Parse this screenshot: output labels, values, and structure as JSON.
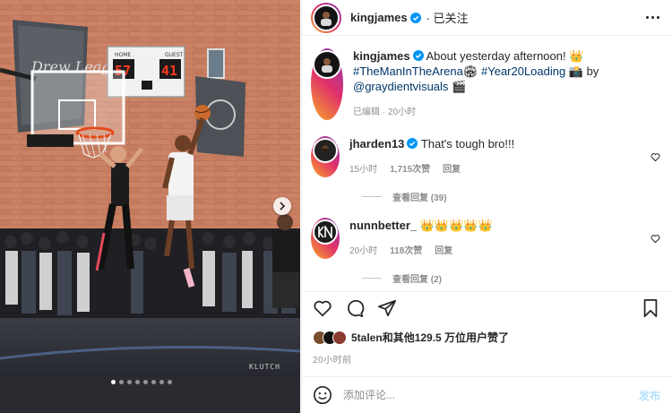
{
  "post": {
    "author": "kingjames",
    "follow_status": "· 已关注",
    "photo_watermark": "KLUTCH",
    "scoreboard": {
      "home_label": "HOME",
      "guest_label": "GUEST",
      "home_score": "57",
      "guest_score": "41"
    },
    "banner_text": "Drew League"
  },
  "caption": {
    "username": "kingjames",
    "text_start": "About yesterday afternoon! 👑",
    "hashtag1": "#TheManInTheArena",
    "emoji1": "🏟",
    "hashtag2": "#Year20Loading",
    "emoji2": "📸",
    "by": "by",
    "mention": "@graydientvisuals",
    "emoji3": "🎬",
    "meta": "已编辑 · 20小时"
  },
  "comments": [
    {
      "username": "jharden13",
      "text": "That's tough bro!!!",
      "time": "15小时",
      "likes": "1,715次赞",
      "reply": "回复",
      "view_replies": "查看回复 (39)"
    },
    {
      "username": "nunnbetter_",
      "text": "👑👑👑👑👑",
      "time": "20小时",
      "likes": "118次赞",
      "reply": "回复",
      "view_replies": "查看回复 (2)"
    }
  ],
  "likes_bar": {
    "user": "5talen",
    "rest": "和其他129.5 万位用户赞了"
  },
  "timestamp": "20小时前",
  "composer": {
    "placeholder": "添加评论...",
    "post_label": "发布"
  },
  "colors": {
    "link": "#00376b",
    "muted": "#8e8e8e",
    "verified": "#0095f6",
    "post_disabled": "#b2dffc"
  },
  "icons": [
    "heart-icon",
    "comment-icon",
    "share-icon",
    "bookmark-icon",
    "emoji-icon",
    "more-icon",
    "verified-icon",
    "chevron-right-icon"
  ],
  "carousel": {
    "total_slides": 8,
    "active_slide": 1
  }
}
